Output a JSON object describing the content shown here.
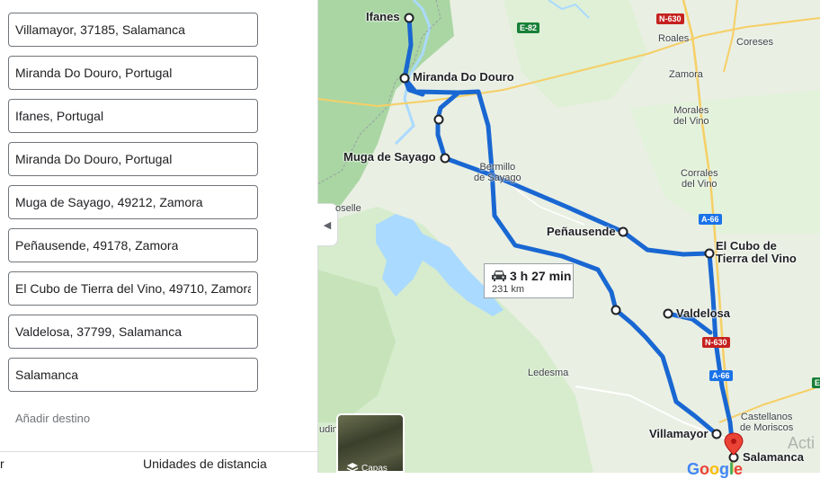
{
  "stops": [
    "Villamayor, 37185, Salamanca",
    "Miranda Do Douro, Portugal",
    "Ifanes, Portugal",
    "Miranda Do Douro, Portugal",
    "Muga de Sayago, 49212, Zamora",
    "Peñausende, 49178, Zamora",
    "El Cubo de Tierra del Vino, 49710, Zamora",
    "Valdelosa, 37799, Salamanca",
    "Salamanca"
  ],
  "add_destination": "Añadir destino",
  "bottom_options": {
    "left_fragment": "r",
    "distance_units": "Unidades de distancia"
  },
  "route": {
    "duration": "3 h 27 min",
    "distance": "231 km"
  },
  "layers_label": "Capas",
  "watermark": "Acti",
  "map_labels": {
    "ifanes": "Ifanes",
    "miranda": "Miranda Do Douro",
    "muga": "Muga de Sayago",
    "bermillo_1": "Bermillo",
    "bermillo_2": "de Sayago",
    "penausende": "Peñausende",
    "cubo_1": "El Cubo de",
    "cubo_2": "Tierra del Vino",
    "valdelosa": "Valdelosa",
    "villamayor": "Villamayor",
    "salamanca": "Salamanca",
    "ledesma": "Ledesma",
    "roales": "Roales",
    "coreses": "Coreses",
    "zamora": "Zamora",
    "morales_1": "Morales",
    "morales_2": "del Vino",
    "corrales_1": "Corrales",
    "corrales_2": "del Vino",
    "castellanos_1": "Castellanos",
    "castellanos_2": "de Moriscos",
    "moselle": "oselle",
    "fudin": "udin"
  },
  "road_shields": {
    "n630_top": "N-630",
    "e82": "E-82",
    "a66_top": "A-66",
    "n630_mid": "N-630",
    "a66_mid": "A-66",
    "e_bottom": "E"
  },
  "colors": {
    "route": "#1a73e8",
    "pin": "#ea4335",
    "water": "#aadaff",
    "green": "#a8d5a2"
  }
}
